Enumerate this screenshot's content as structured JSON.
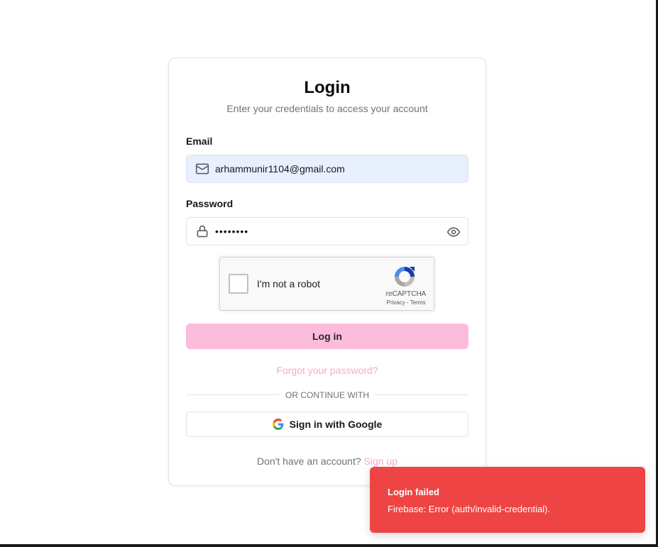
{
  "login": {
    "title": "Login",
    "subtitle": "Enter your credentials to access your account",
    "email_label": "Email",
    "email_value": "arhammunir1104@gmail.com",
    "password_label": "Password",
    "password_masked": "••••••••",
    "captcha": {
      "label": "I'm not a robot",
      "brand": "reCAPTCHA",
      "links": "Privacy - Terms"
    },
    "login_button": "Log in",
    "forgot_link": "Forgot your password?",
    "divider_text": "OR CONTINUE WITH",
    "google_button": "Sign in with Google",
    "signup_prompt": "Don't have an account?",
    "signup_link": "Sign up"
  },
  "toast": {
    "title": "Login failed",
    "description": "Firebase: Error (auth/invalid-credential)."
  },
  "icons": {
    "email": "mail-icon",
    "password": "lock-icon",
    "reveal": "eye-icon",
    "google": "google-icon",
    "captcha": "recaptcha-icon"
  },
  "colors": {
    "accent": "#fbbcdc",
    "link": "#f9a8d4",
    "error": "#ef4444",
    "autofill": "#e8f0fe"
  }
}
